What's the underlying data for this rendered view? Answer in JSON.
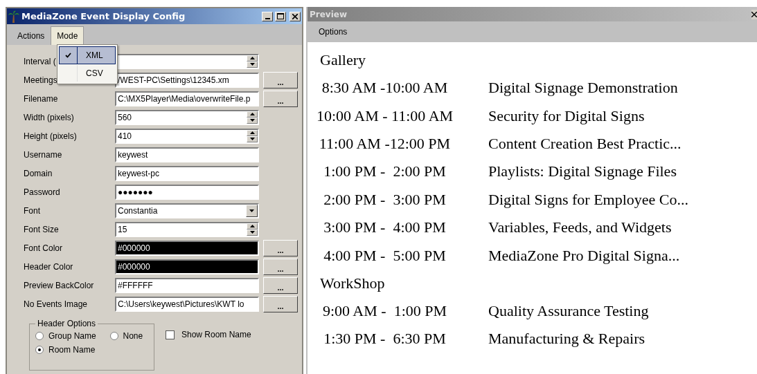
{
  "config_window": {
    "title": "MediaZone Event Display Config",
    "menu": [
      {
        "label": "Actions",
        "selected": false
      },
      {
        "label": "Mode",
        "selected": true
      }
    ],
    "mode_menu": [
      {
        "label": "XML",
        "checked": true,
        "selected": true
      },
      {
        "label": "CSV",
        "checked": false,
        "selected": false
      }
    ],
    "fields": [
      {
        "label": "Interval (",
        "kind": "spin"
      },
      {
        "label": "Meetings",
        "kind": "file",
        "value": "/WEST-PC\\Settings\\12345.xm",
        "button": "..."
      },
      {
        "label": "Filename",
        "kind": "file",
        "value": "C:\\MX5Player\\Media\\overwriteFile.p",
        "button": "..."
      },
      {
        "label": "Width (pixels)",
        "kind": "spin",
        "value": "560"
      },
      {
        "label": "Height (pixels)",
        "kind": "spin",
        "value": "410"
      },
      {
        "label": "Username",
        "kind": "text",
        "value": "keywest"
      },
      {
        "label": "Domain",
        "kind": "text",
        "value": "keywest-pc"
      },
      {
        "label": "Password",
        "kind": "text",
        "value": "●●●●●●●"
      },
      {
        "label": "Font",
        "kind": "combo",
        "value": "Constantia"
      },
      {
        "label": "Font Size",
        "kind": "spin",
        "value": "15"
      },
      {
        "label": "Font Color",
        "kind": "color",
        "value": "#000000",
        "button": "..."
      },
      {
        "label": "Header Color",
        "kind": "color",
        "value": "#000000",
        "button": "..."
      },
      {
        "label": "Preview BackColor",
        "kind": "color",
        "value": "#FFFFFF",
        "button": "..."
      },
      {
        "label": "No Events Image",
        "kind": "file",
        "value": "C:\\Users\\keywest\\Pictures\\KWT lo",
        "button": "..."
      }
    ],
    "header_options": {
      "title": "Header Options",
      "options": [
        {
          "label": "Group Name",
          "selected": false
        },
        {
          "label": "None",
          "selected": false
        },
        {
          "label": "Room Name",
          "selected": true
        }
      ]
    },
    "show_room_name": {
      "label": "Show Room Name",
      "checked": false
    }
  },
  "preview_window": {
    "title": "Preview",
    "menu": [
      "Options"
    ],
    "groups": [
      {
        "name": "Gallery",
        "events": [
          {
            "time": "8:30 AM -10:00 AM",
            "title": "Digital Signage Demonstration"
          },
          {
            "time": "10:00 AM - 11:00 AM",
            "title": "Security for Digital Signs"
          },
          {
            "time": "11:00 AM -12:00 PM",
            "title": "Content Creation Best Practic..."
          },
          {
            "time": "1:00 PM -  2:00 PM",
            "title": "Playlists: Digital Signage Files"
          },
          {
            "time": "2:00 PM -  3:00 PM",
            "title": "Digital Signs for Employee Co..."
          },
          {
            "time": "3:00 PM -  4:00 PM",
            "title": "Variables, Feeds, and Widgets"
          },
          {
            "time": "4:00 PM -  5:00 PM",
            "title": "MediaZone Pro Digital Signa..."
          }
        ]
      },
      {
        "name": "WorkShop",
        "events": [
          {
            "time": "9:00 AM -  1:00 PM",
            "title": "Quality Assurance Testing"
          },
          {
            "time": "1:30 PM -  6:30 PM",
            "title": "Manufacturing & Repairs"
          }
        ]
      }
    ]
  }
}
